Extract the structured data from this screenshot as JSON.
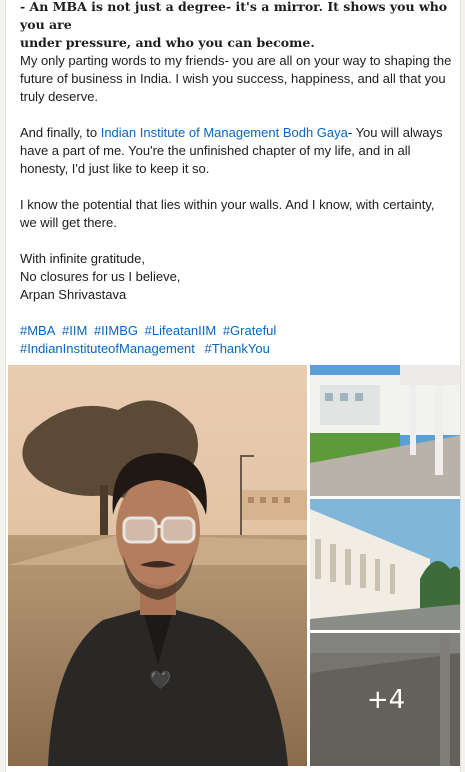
{
  "post": {
    "quote_line1": "- An MBA is not just a degree- it's a mirror. It shows you who you are",
    "quote_line2": "under pressure, and who you can become.",
    "para1": "My only parting words to my friends- you are all on your way to shaping the future of business in India. I wish you success, happiness, and all that you truly deserve.",
    "para2_prefix": "And finally, to ",
    "para2_link": "Indian Institute of Management Bodh Gaya",
    "para2_suffix": "- You will always have a part of me. You're the unfinished chapter of my life, and in all honesty, I'd just like to keep it so.",
    "para3": "I know the potential that lies within your walls. And I know, with certainty, we will get there.",
    "sign1": "With infinite gratitude,",
    "sign2": "No closures for us I believe,",
    "sign3": "Arpan Shrivastava",
    "hashtags": [
      "#MBA",
      "#IIM",
      "#IIMBG",
      "#LifeatanIIM",
      "#Grateful",
      "#IndianInstituteofManagement",
      "#ThankYou"
    ]
  },
  "gallery": {
    "more_label": "+4",
    "heart_emoji": "🖤"
  }
}
